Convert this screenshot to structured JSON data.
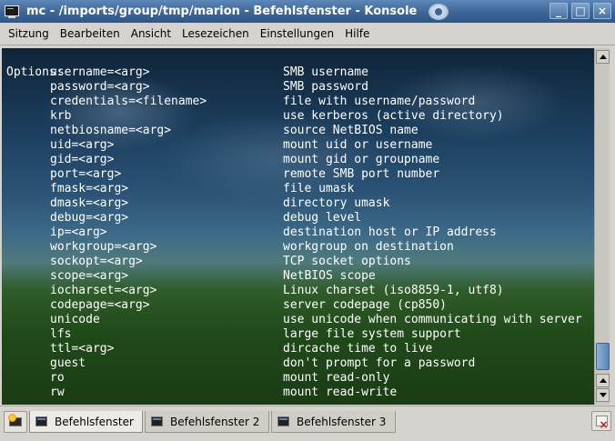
{
  "window": {
    "title": "mc - /imports/group/tmp/marion - Befehlsfenster - Konsole",
    "buttons": {
      "minimize": "_",
      "maximize": "□",
      "close": "×"
    }
  },
  "menu": [
    "Sitzung",
    "Bearbeiten",
    "Ansicht",
    "Lesezeichen",
    "Einstellungen",
    "Hilfe"
  ],
  "terminal": {
    "header": "Options:",
    "options": [
      {
        "opt": "username=<arg>",
        "desc": "SMB username"
      },
      {
        "opt": "password=<arg>",
        "desc": "SMB password"
      },
      {
        "opt": "credentials=<filename>",
        "desc": "file with username/password"
      },
      {
        "opt": "krb",
        "desc": "use kerberos (active directory)"
      },
      {
        "opt": "netbiosname=<arg>",
        "desc": "source NetBIOS name"
      },
      {
        "opt": "uid=<arg>",
        "desc": "mount uid or username"
      },
      {
        "opt": "gid=<arg>",
        "desc": "mount gid or groupname"
      },
      {
        "opt": "port=<arg>",
        "desc": "remote SMB port number"
      },
      {
        "opt": "fmask=<arg>",
        "desc": "file umask"
      },
      {
        "opt": "dmask=<arg>",
        "desc": "directory umask"
      },
      {
        "opt": "debug=<arg>",
        "desc": "debug level"
      },
      {
        "opt": "ip=<arg>",
        "desc": "destination host or IP address"
      },
      {
        "opt": "workgroup=<arg>",
        "desc": "workgroup on destination"
      },
      {
        "opt": "sockopt=<arg>",
        "desc": "TCP socket options"
      },
      {
        "opt": "scope=<arg>",
        "desc": "NetBIOS scope"
      },
      {
        "opt": "iocharset=<arg>",
        "desc": "Linux charset (iso8859-1, utf8)"
      },
      {
        "opt": "codepage=<arg>",
        "desc": "server codepage (cp850)"
      },
      {
        "opt": "unicode",
        "desc": "use unicode when communicating with server"
      },
      {
        "opt": "lfs",
        "desc": "large file system support"
      },
      {
        "opt": "ttl=<arg>",
        "desc": "dircache time to live"
      },
      {
        "opt": "guest",
        "desc": "don't prompt for a password"
      },
      {
        "opt": "ro",
        "desc": "mount read-only"
      },
      {
        "opt": "rw",
        "desc": "mount read-write"
      }
    ]
  },
  "scrollbar": {
    "position_fraction": 0.9
  },
  "tabs": [
    {
      "label": "Befehlsfenster",
      "active": true
    },
    {
      "label": "Befehlsfenster 2",
      "active": false
    },
    {
      "label": "Befehlsfenster 3",
      "active": false
    }
  ],
  "icons": {
    "app": "konsole-icon",
    "sticky": "sticky-icon",
    "new_session": "new-session-icon",
    "close_session": "close-session-icon"
  },
  "colors": {
    "titlebar": "#3d6697",
    "terminal_text": "#ffffff",
    "chrome": "#d6d3ce"
  }
}
